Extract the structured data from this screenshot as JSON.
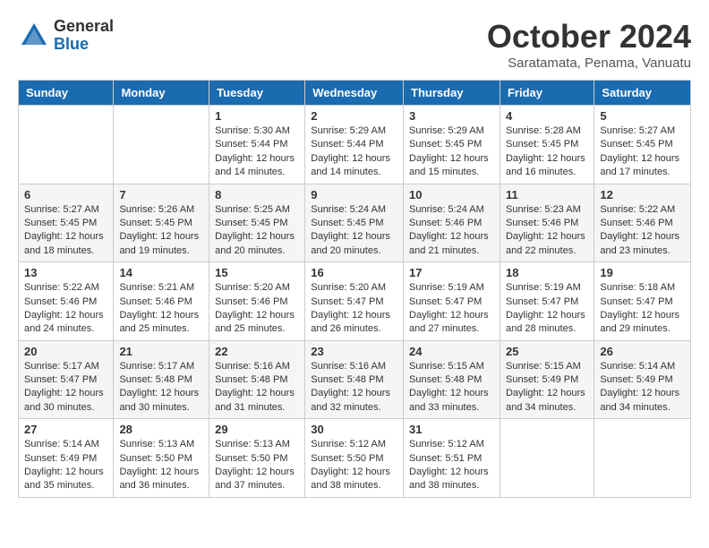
{
  "logo": {
    "general": "General",
    "blue": "Blue"
  },
  "title": "October 2024",
  "location": "Saratamata, Penama, Vanuatu",
  "days_of_week": [
    "Sunday",
    "Monday",
    "Tuesday",
    "Wednesday",
    "Thursday",
    "Friday",
    "Saturday"
  ],
  "weeks": [
    [
      {
        "day": "",
        "sunrise": "",
        "sunset": "",
        "daylight": ""
      },
      {
        "day": "",
        "sunrise": "",
        "sunset": "",
        "daylight": ""
      },
      {
        "day": "1",
        "sunrise": "Sunrise: 5:30 AM",
        "sunset": "Sunset: 5:44 PM",
        "daylight": "Daylight: 12 hours and 14 minutes."
      },
      {
        "day": "2",
        "sunrise": "Sunrise: 5:29 AM",
        "sunset": "Sunset: 5:44 PM",
        "daylight": "Daylight: 12 hours and 14 minutes."
      },
      {
        "day": "3",
        "sunrise": "Sunrise: 5:29 AM",
        "sunset": "Sunset: 5:45 PM",
        "daylight": "Daylight: 12 hours and 15 minutes."
      },
      {
        "day": "4",
        "sunrise": "Sunrise: 5:28 AM",
        "sunset": "Sunset: 5:45 PM",
        "daylight": "Daylight: 12 hours and 16 minutes."
      },
      {
        "day": "5",
        "sunrise": "Sunrise: 5:27 AM",
        "sunset": "Sunset: 5:45 PM",
        "daylight": "Daylight: 12 hours and 17 minutes."
      }
    ],
    [
      {
        "day": "6",
        "sunrise": "Sunrise: 5:27 AM",
        "sunset": "Sunset: 5:45 PM",
        "daylight": "Daylight: 12 hours and 18 minutes."
      },
      {
        "day": "7",
        "sunrise": "Sunrise: 5:26 AM",
        "sunset": "Sunset: 5:45 PM",
        "daylight": "Daylight: 12 hours and 19 minutes."
      },
      {
        "day": "8",
        "sunrise": "Sunrise: 5:25 AM",
        "sunset": "Sunset: 5:45 PM",
        "daylight": "Daylight: 12 hours and 20 minutes."
      },
      {
        "day": "9",
        "sunrise": "Sunrise: 5:24 AM",
        "sunset": "Sunset: 5:45 PM",
        "daylight": "Daylight: 12 hours and 20 minutes."
      },
      {
        "day": "10",
        "sunrise": "Sunrise: 5:24 AM",
        "sunset": "Sunset: 5:46 PM",
        "daylight": "Daylight: 12 hours and 21 minutes."
      },
      {
        "day": "11",
        "sunrise": "Sunrise: 5:23 AM",
        "sunset": "Sunset: 5:46 PM",
        "daylight": "Daylight: 12 hours and 22 minutes."
      },
      {
        "day": "12",
        "sunrise": "Sunrise: 5:22 AM",
        "sunset": "Sunset: 5:46 PM",
        "daylight": "Daylight: 12 hours and 23 minutes."
      }
    ],
    [
      {
        "day": "13",
        "sunrise": "Sunrise: 5:22 AM",
        "sunset": "Sunset: 5:46 PM",
        "daylight": "Daylight: 12 hours and 24 minutes."
      },
      {
        "day": "14",
        "sunrise": "Sunrise: 5:21 AM",
        "sunset": "Sunset: 5:46 PM",
        "daylight": "Daylight: 12 hours and 25 minutes."
      },
      {
        "day": "15",
        "sunrise": "Sunrise: 5:20 AM",
        "sunset": "Sunset: 5:46 PM",
        "daylight": "Daylight: 12 hours and 25 minutes."
      },
      {
        "day": "16",
        "sunrise": "Sunrise: 5:20 AM",
        "sunset": "Sunset: 5:47 PM",
        "daylight": "Daylight: 12 hours and 26 minutes."
      },
      {
        "day": "17",
        "sunrise": "Sunrise: 5:19 AM",
        "sunset": "Sunset: 5:47 PM",
        "daylight": "Daylight: 12 hours and 27 minutes."
      },
      {
        "day": "18",
        "sunrise": "Sunrise: 5:19 AM",
        "sunset": "Sunset: 5:47 PM",
        "daylight": "Daylight: 12 hours and 28 minutes."
      },
      {
        "day": "19",
        "sunrise": "Sunrise: 5:18 AM",
        "sunset": "Sunset: 5:47 PM",
        "daylight": "Daylight: 12 hours and 29 minutes."
      }
    ],
    [
      {
        "day": "20",
        "sunrise": "Sunrise: 5:17 AM",
        "sunset": "Sunset: 5:47 PM",
        "daylight": "Daylight: 12 hours and 30 minutes."
      },
      {
        "day": "21",
        "sunrise": "Sunrise: 5:17 AM",
        "sunset": "Sunset: 5:48 PM",
        "daylight": "Daylight: 12 hours and 30 minutes."
      },
      {
        "day": "22",
        "sunrise": "Sunrise: 5:16 AM",
        "sunset": "Sunset: 5:48 PM",
        "daylight": "Daylight: 12 hours and 31 minutes."
      },
      {
        "day": "23",
        "sunrise": "Sunrise: 5:16 AM",
        "sunset": "Sunset: 5:48 PM",
        "daylight": "Daylight: 12 hours and 32 minutes."
      },
      {
        "day": "24",
        "sunrise": "Sunrise: 5:15 AM",
        "sunset": "Sunset: 5:48 PM",
        "daylight": "Daylight: 12 hours and 33 minutes."
      },
      {
        "day": "25",
        "sunrise": "Sunrise: 5:15 AM",
        "sunset": "Sunset: 5:49 PM",
        "daylight": "Daylight: 12 hours and 34 minutes."
      },
      {
        "day": "26",
        "sunrise": "Sunrise: 5:14 AM",
        "sunset": "Sunset: 5:49 PM",
        "daylight": "Daylight: 12 hours and 34 minutes."
      }
    ],
    [
      {
        "day": "27",
        "sunrise": "Sunrise: 5:14 AM",
        "sunset": "Sunset: 5:49 PM",
        "daylight": "Daylight: 12 hours and 35 minutes."
      },
      {
        "day": "28",
        "sunrise": "Sunrise: 5:13 AM",
        "sunset": "Sunset: 5:50 PM",
        "daylight": "Daylight: 12 hours and 36 minutes."
      },
      {
        "day": "29",
        "sunrise": "Sunrise: 5:13 AM",
        "sunset": "Sunset: 5:50 PM",
        "daylight": "Daylight: 12 hours and 37 minutes."
      },
      {
        "day": "30",
        "sunrise": "Sunrise: 5:12 AM",
        "sunset": "Sunset: 5:50 PM",
        "daylight": "Daylight: 12 hours and 38 minutes."
      },
      {
        "day": "31",
        "sunrise": "Sunrise: 5:12 AM",
        "sunset": "Sunset: 5:51 PM",
        "daylight": "Daylight: 12 hours and 38 minutes."
      },
      {
        "day": "",
        "sunrise": "",
        "sunset": "",
        "daylight": ""
      },
      {
        "day": "",
        "sunrise": "",
        "sunset": "",
        "daylight": ""
      }
    ]
  ]
}
